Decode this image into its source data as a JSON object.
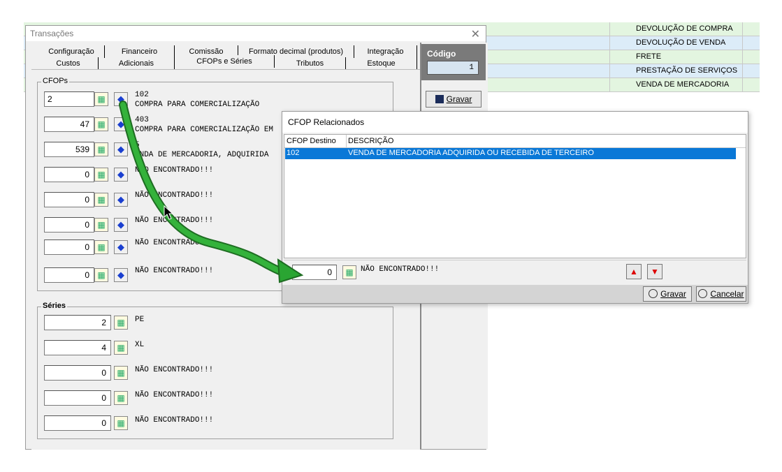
{
  "background_rows": [
    {
      "text": "DEVOLUÇÃO DE COMPRA",
      "left": "1",
      "color": "#e3f5e0"
    },
    {
      "text": "DEVOLUÇÃO DE VENDA",
      "left": "1",
      "color": "#dcecf8"
    },
    {
      "text": "FRETE",
      "left": "1",
      "color": "#e3f5e0"
    },
    {
      "text": "PRESTAÇÃO DE SERVIÇOS",
      "left": "1",
      "color": "#dcecf8"
    },
    {
      "text": "VENDA DE MERCADORIA",
      "left": "1",
      "color": "#e3f5e0"
    }
  ],
  "window": {
    "title": "Transações",
    "close_glyph": "✕",
    "tabs_row1": [
      "Configuração",
      "Financeiro",
      "Comissão",
      "Formato decimal (produtos)",
      "Integração"
    ],
    "tabs_row2": [
      "Custos",
      "Adicionais",
      "CFOPs e Séries",
      "Tributos",
      "Estoque"
    ],
    "codigo_label": "Código",
    "codigo_value": "1",
    "gravar_label": "Gravar",
    "cfops_label": "CFOPs",
    "series_label": "Séries"
  },
  "cfops": [
    {
      "value": "2",
      "line1": "102",
      "line2": "COMPRA PARA COMERCIALIZAÇÃO"
    },
    {
      "value": "47",
      "line1": "403",
      "line2": "COMPRA PARA COMERCIALIZAÇÃO EM"
    },
    {
      "value": "539",
      "line1": "5",
      "line2": "VNDA DE MERCADORIA, ADQUIRIDA"
    },
    {
      "value": "0",
      "line1": "NÃO ENCONTRADO!!!",
      "line2": ""
    },
    {
      "value": "0",
      "line1": "NÃO ENCONTRADO!!!",
      "line2": ""
    },
    {
      "value": "0",
      "line1": "NÃO ENCONTRADO!!!",
      "line2": ""
    },
    {
      "value": "0",
      "line1": "NÃO ENCONTRADO!!!",
      "line2": ""
    },
    {
      "value": "0",
      "line1": "NÃO ENCONTRADO!!!",
      "line2": ""
    }
  ],
  "series": [
    {
      "value": "2",
      "desc": "PE"
    },
    {
      "value": "4",
      "desc": "XL"
    },
    {
      "value": "0",
      "desc": "NÃO ENCONTRADO!!!"
    },
    {
      "value": "0",
      "desc": "NÃO ENCONTRADO!!!"
    },
    {
      "value": "0",
      "desc": "NÃO ENCONTRADO!!!"
    }
  ],
  "dialog": {
    "title": "CFOP Relacionados",
    "col1": "CFOP Destino",
    "col2": "DESCRIÇÃO",
    "row": {
      "cfop": "102",
      "desc": "VENDA DE MERCADORIA ADQUIRIDA OU RECEBIDA DE TERCEIRO"
    },
    "field_value": "0",
    "field_desc": "NÃO ENCONTRADO!!!",
    "gravar_label": "Gravar",
    "cancelar_label": "Cancelar",
    "selection_color": "#0a78d7"
  },
  "icons": {
    "lookup": "lookup-icon",
    "erase": "eraser-icon",
    "up": "arrow-up-icon",
    "down": "arrow-down-icon",
    "save": "floppy-icon",
    "cancel": "cancel-icon"
  },
  "arrow_color": "#22a12e"
}
